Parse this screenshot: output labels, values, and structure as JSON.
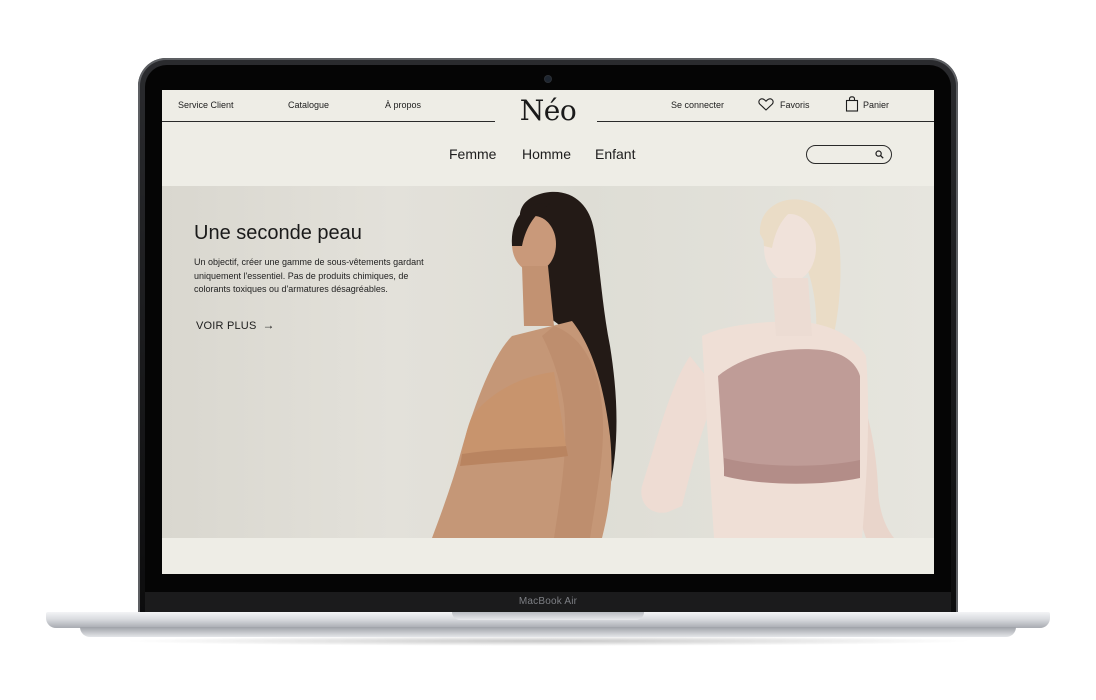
{
  "device": {
    "label": "MacBook Air"
  },
  "site": {
    "logo": "Néo",
    "topbar": {
      "service_client": "Service Client",
      "catalogue": "Catalogue",
      "a_propos": "À propos",
      "se_connecter": "Se connecter",
      "favoris": "Favoris",
      "panier": "Panier"
    },
    "nav": {
      "femme": "Femme",
      "homme": "Homme",
      "enfant": "Enfant"
    },
    "search": {
      "placeholder": "",
      "icon": "search-icon"
    },
    "hero": {
      "title": "Une seconde peau",
      "text": "Un objectif, créer une gamme de sous-vêtements gardant uniquement l'essentiel. Pas de produits chimiques, de colorants toxiques ou d'armatures désagréables.",
      "cta": "VOIR PLUS",
      "cta_arrow": "→"
    }
  },
  "colors": {
    "page_bg": "#eeede6",
    "hero_bg": "#deddd5",
    "text": "#1d1d1d",
    "bra_left": "#c79a78",
    "bra_right": "#bf9c97"
  }
}
